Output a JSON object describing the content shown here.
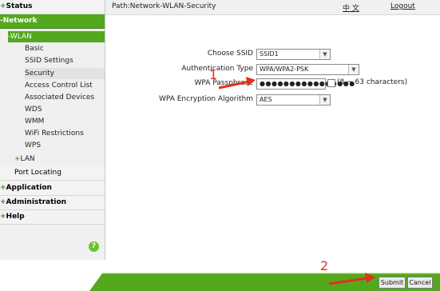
{
  "sidebar": {
    "status": "Status",
    "network": "Network",
    "wlan": "WLAN",
    "wlan_items": [
      "Basic",
      "SSID Settings",
      "Security",
      "Access Control List",
      "Associated Devices",
      "WDS",
      "WMM",
      "WiFi Restrictions",
      "WPS"
    ],
    "lan": "LAN",
    "port_locating": "Port Locating",
    "application": "Application",
    "administration": "Administration",
    "help": "Help",
    "help_icon": "?"
  },
  "header": {
    "path": "Path:Network-WLAN-Security",
    "language": "中 文",
    "logout": "Logout"
  },
  "form": {
    "ssid_label": "Choose SSID",
    "ssid_value": "SSID1",
    "auth_label": "Authentication Type",
    "auth_value": "WPA/WPA2-PSK",
    "pass_label": "WPA Passphrase",
    "pass_value": "●●●●●●●●●●●●●●●●",
    "pass_hint": "(8 ~ 63 characters)",
    "enc_label": "WPA Encryption Algorithm",
    "enc_value": "AES"
  },
  "footer": {
    "submit": "Submit",
    "cancel": "Cancel"
  },
  "annotations": {
    "step1": "1",
    "step2": "2",
    "color": "#e03121"
  },
  "colors": {
    "accent_green": "#54a81e"
  }
}
